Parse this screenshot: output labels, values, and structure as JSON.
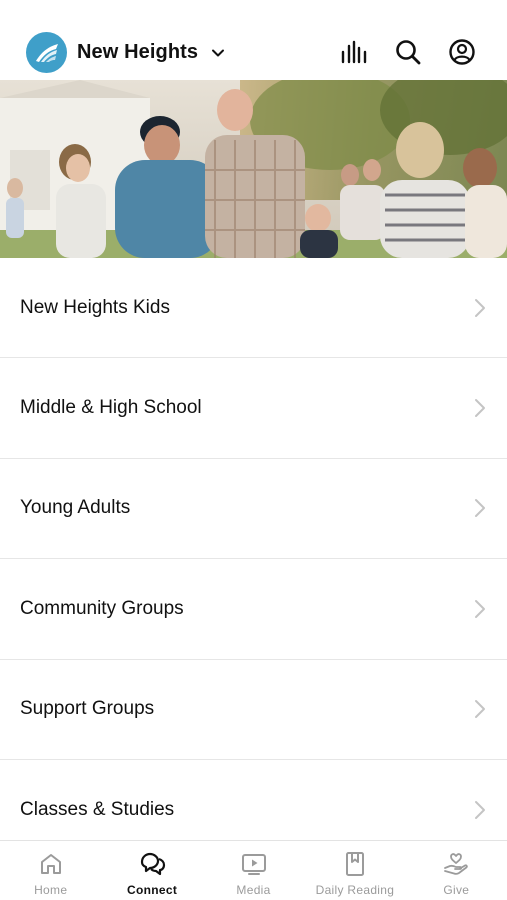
{
  "header": {
    "title": "New Heights",
    "icons": [
      "audio-bars-icon",
      "search-icon",
      "profile-icon"
    ]
  },
  "hero": {
    "image": "group-of-people-outdoors"
  },
  "menu": {
    "items": [
      {
        "label": "New Heights Kids"
      },
      {
        "label": "Middle & High School"
      },
      {
        "label": "Young Adults"
      },
      {
        "label": "Community Groups"
      },
      {
        "label": "Support Groups"
      },
      {
        "label": "Classes & Studies"
      }
    ]
  },
  "tabbar": {
    "tabs": [
      {
        "label": "Home",
        "icon": "home-icon",
        "active": false
      },
      {
        "label": "Connect",
        "icon": "chat-bubbles-icon",
        "active": true
      },
      {
        "label": "Media",
        "icon": "tv-play-icon",
        "active": false
      },
      {
        "label": "Daily Reading",
        "icon": "bookmark-book-icon",
        "active": false
      },
      {
        "label": "Give",
        "icon": "heart-hand-icon",
        "active": false
      }
    ]
  },
  "colors": {
    "brand": "#3f9fc9",
    "active_tab": "#111111",
    "inactive_tab": "#9b9b9b",
    "divider": "#e6e6e6"
  }
}
